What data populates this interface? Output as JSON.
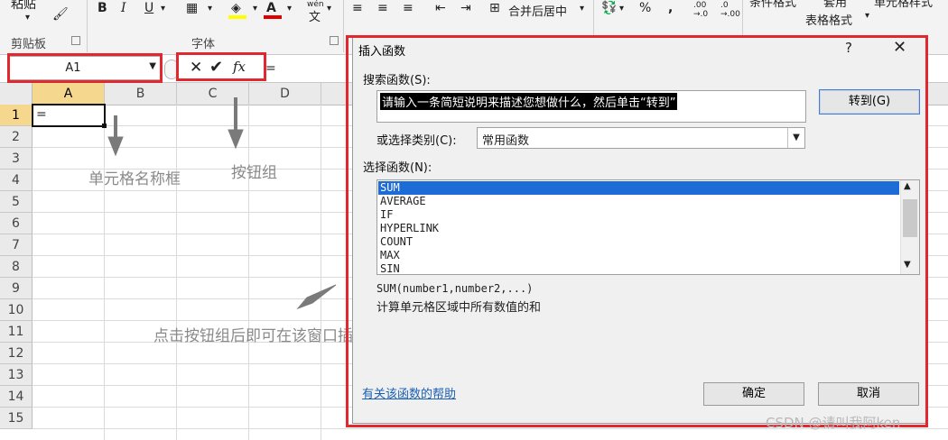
{
  "ribbon": {
    "paste_label": "粘贴",
    "clipboard_label": "剪贴板",
    "font_label": "字体",
    "bold": "B",
    "italic": "I",
    "underline": "U",
    "phonetic": "wén",
    "merge_center": "合并后居中",
    "percent": "%",
    "comma": ",",
    "cond_format": "条件格式",
    "table_apply": "套用",
    "table_format": "表格格式",
    "cell_style": "单元格样式"
  },
  "formula_bar": {
    "name_box": "A1",
    "formula": "="
  },
  "sheet": {
    "columns": [
      "A",
      "B",
      "C",
      "D"
    ],
    "rows": [
      "1",
      "2",
      "3",
      "4",
      "5",
      "6",
      "7",
      "8",
      "9",
      "10",
      "11",
      "12",
      "13",
      "14",
      "15"
    ],
    "selected_col": "A",
    "selected_row": "1",
    "a1_value": "="
  },
  "annotations": {
    "name_box": "单元格名称框",
    "button_group": "按钮组",
    "dialog_note": "点击按钮组后即可在该窗口插入函数"
  },
  "dialog": {
    "title": "插入函数",
    "help": "?",
    "close": "✕",
    "search_label": "搜索函数(S):",
    "search_text": "请输入一条简短说明来描述您想做什么，然后单击“转到”",
    "goto_button": "转到(G)",
    "category_label": "或选择类别(C):",
    "category_value": "常用函数",
    "select_label": "选择函数(N):",
    "functions": [
      "SUM",
      "AVERAGE",
      "IF",
      "HYPERLINK",
      "COUNT",
      "MAX",
      "SIN"
    ],
    "selected_function": "SUM",
    "signature": "SUM(number1,number2,...)",
    "description": "计算单元格区域中所有数值的和",
    "help_link": "有关该函数的帮助",
    "ok": "确定",
    "cancel": "取消"
  },
  "watermark": "CSDN @请叫我阿ken",
  "colors": {
    "highlight_red": "#e0282e",
    "selection_blue": "#1c6bd6",
    "header_selected": "#f5d88e"
  }
}
